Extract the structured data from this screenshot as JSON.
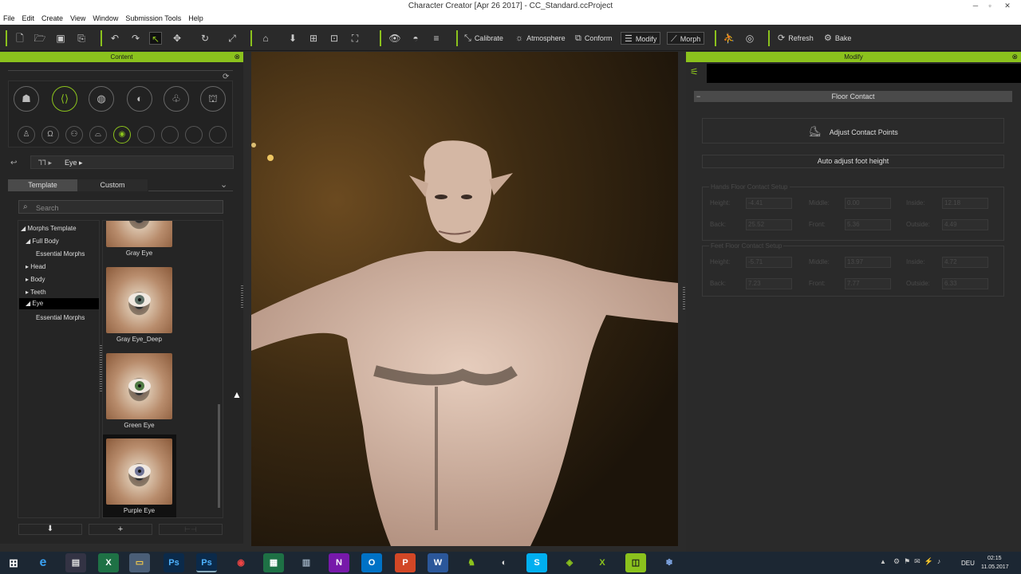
{
  "window": {
    "title": "Character Creator [Apr 26 2017] - CC_Standard.ccProject"
  },
  "menu": [
    "File",
    "Edit",
    "Create",
    "View",
    "Window",
    "Submission Tools",
    "Help"
  ],
  "toolbar": {
    "calibrate": "Calibrate",
    "atmosphere": "Atmosphere",
    "conform": "Conform",
    "modify": "Modify",
    "morph": "Morph",
    "refresh": "Refresh",
    "bake": "Bake"
  },
  "content_panel": {
    "title": "Content",
    "breadcrumb": "Eye",
    "tabs": [
      "Template",
      "Custom"
    ],
    "search_placeholder": "Search",
    "tree": [
      {
        "label": "Morphs Template"
      },
      {
        "label": "Full Body"
      },
      {
        "label": "Essential Morphs"
      },
      {
        "label": "Head"
      },
      {
        "label": "Body"
      },
      {
        "label": "Teeth"
      },
      {
        "label": "Eye"
      },
      {
        "label": "Essential Morphs"
      }
    ],
    "items": [
      {
        "label": "Gray Eye",
        "iris": "#7b8288"
      },
      {
        "label": "Gray Eye_Deep",
        "iris": "#5f7068"
      },
      {
        "label": "Green Eye",
        "iris": "#4f7a44"
      },
      {
        "label": "Purple Eye",
        "iris": "#6e7396"
      }
    ]
  },
  "modify_panel": {
    "title": "Modify",
    "section": "Floor Contact",
    "adjust_button": "Adjust Contact Points",
    "auto_button": "Auto adjust foot height",
    "hands_title": "Hands Floor Contact Setup",
    "feet_title": "Feet Floor Contact Setup",
    "hands": {
      "height": "-4.41",
      "middle": "0.00",
      "inside": "12.18",
      "back": "25.52",
      "front": "5.36",
      "outside": "4.49"
    },
    "feet": {
      "height": "-5.71",
      "middle": "13.97",
      "inside": "4.72",
      "back": "7.23",
      "front": "7.77",
      "outside": "6.33"
    },
    "labels": {
      "height": "Height:",
      "middle": "Middle:",
      "inside": "Inside:",
      "back": "Back:",
      "front": "Front:",
      "outside": "Outside:"
    }
  },
  "taskbar": {
    "lang": "DEU",
    "time": "02:15",
    "date": "11.05.2017"
  },
  "colors": {
    "accent": "#8bc21d"
  }
}
